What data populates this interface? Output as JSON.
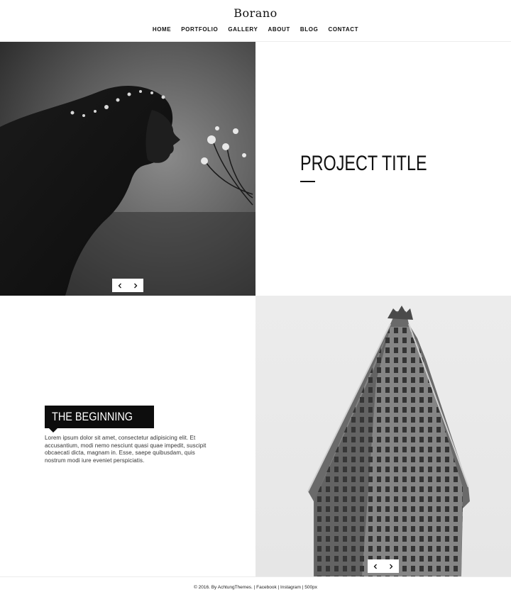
{
  "header": {
    "logo": "Borano",
    "nav": [
      "HOME",
      "PORTFOLIO",
      "GALLERY",
      "ABOUT",
      "BLOG",
      "CONTACT"
    ]
  },
  "hero": {
    "project_title": "PROJECT TITLE"
  },
  "intro": {
    "tag": "THE BEGINNING",
    "body": "Lorem ipsum dolor sit amet, consectetur adipisicing elit. Et accusantium, modi nemo nesciunt quasi quae impedit, suscipit obcaecati dicta, magnam in. Esse, saepe quibusdam, quis nostrum modi iure eveniet perspiciatis."
  },
  "slider": {
    "prev_icon": "chevron-left-icon",
    "next_icon": "chevron-right-icon"
  },
  "footer": {
    "prefix": "© 2016. By AchtungThemes. | ",
    "links": [
      "Facebook",
      "Instagram",
      "500px"
    ],
    "separator": " | "
  },
  "colors": {
    "text": "#111111",
    "tag_bg": "#0d0d0d",
    "background": "#ffffff"
  }
}
